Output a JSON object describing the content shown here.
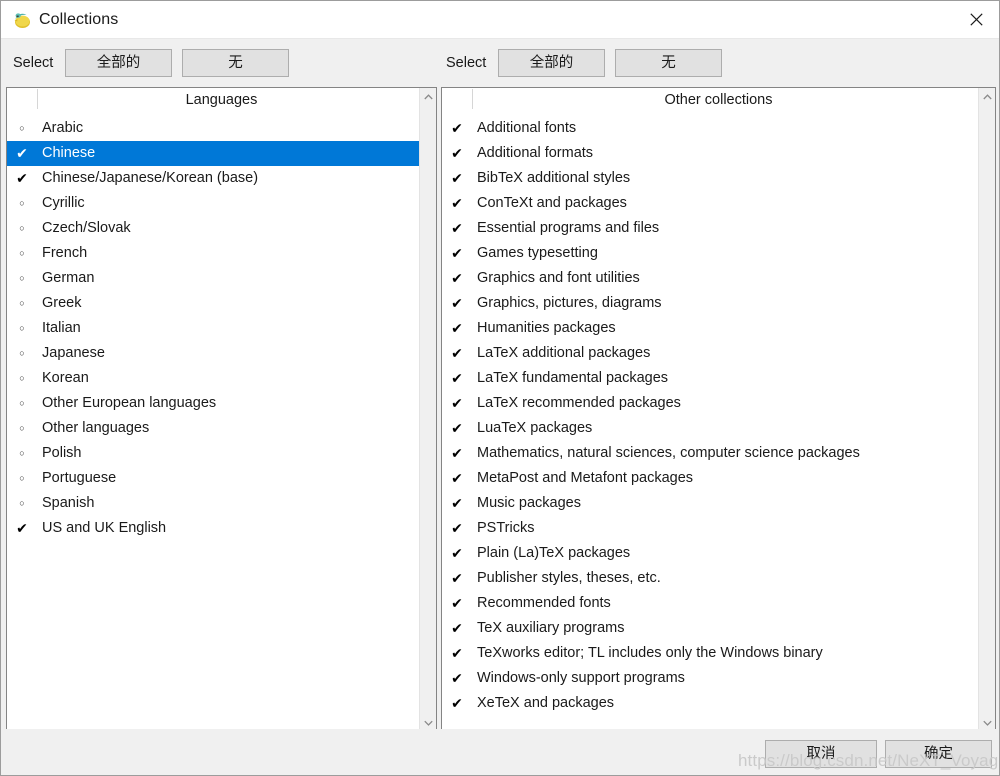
{
  "window": {
    "title": "Collections",
    "icon": "texlive-app-icon",
    "close_label": "✕"
  },
  "toolbar": {
    "left": {
      "select_label": "Select",
      "all_button": "全部的",
      "none_button": "无"
    },
    "right": {
      "select_label": "Select",
      "all_button": "全部的",
      "none_button": "无"
    }
  },
  "lists": {
    "languages": {
      "header": "Languages",
      "checked_glyph": "✔",
      "unchecked_glyph": "○",
      "items": [
        {
          "label": "Arabic",
          "checked": false,
          "selected": false
        },
        {
          "label": "Chinese",
          "checked": true,
          "selected": true
        },
        {
          "label": "Chinese/Japanese/Korean (base)",
          "checked": true,
          "selected": false
        },
        {
          "label": "Cyrillic",
          "checked": false,
          "selected": false
        },
        {
          "label": "Czech/Slovak",
          "checked": false,
          "selected": false
        },
        {
          "label": "French",
          "checked": false,
          "selected": false
        },
        {
          "label": "German",
          "checked": false,
          "selected": false
        },
        {
          "label": "Greek",
          "checked": false,
          "selected": false
        },
        {
          "label": "Italian",
          "checked": false,
          "selected": false
        },
        {
          "label": "Japanese",
          "checked": false,
          "selected": false
        },
        {
          "label": "Korean",
          "checked": false,
          "selected": false
        },
        {
          "label": "Other European languages",
          "checked": false,
          "selected": false
        },
        {
          "label": "Other languages",
          "checked": false,
          "selected": false
        },
        {
          "label": "Polish",
          "checked": false,
          "selected": false
        },
        {
          "label": "Portuguese",
          "checked": false,
          "selected": false
        },
        {
          "label": "Spanish",
          "checked": false,
          "selected": false
        },
        {
          "label": "US and UK English",
          "checked": true,
          "selected": false
        }
      ]
    },
    "other_collections": {
      "header": "Other collections",
      "checked_glyph": "✔",
      "unchecked_glyph": "○",
      "items": [
        {
          "label": "Additional fonts",
          "checked": true,
          "selected": false
        },
        {
          "label": "Additional formats",
          "checked": true,
          "selected": false
        },
        {
          "label": "BibTeX additional styles",
          "checked": true,
          "selected": false
        },
        {
          "label": "ConTeXt and packages",
          "checked": true,
          "selected": false
        },
        {
          "label": "Essential programs and files",
          "checked": true,
          "selected": false
        },
        {
          "label": "Games typesetting",
          "checked": true,
          "selected": false
        },
        {
          "label": "Graphics and font utilities",
          "checked": true,
          "selected": false
        },
        {
          "label": "Graphics, pictures, diagrams",
          "checked": true,
          "selected": false
        },
        {
          "label": "Humanities packages",
          "checked": true,
          "selected": false
        },
        {
          "label": "LaTeX additional packages",
          "checked": true,
          "selected": false
        },
        {
          "label": "LaTeX fundamental packages",
          "checked": true,
          "selected": false
        },
        {
          "label": "LaTeX recommended packages",
          "checked": true,
          "selected": false
        },
        {
          "label": "LuaTeX packages",
          "checked": true,
          "selected": false
        },
        {
          "label": "Mathematics, natural sciences, computer science packages",
          "checked": true,
          "selected": false
        },
        {
          "label": "MetaPost and Metafont packages",
          "checked": true,
          "selected": false
        },
        {
          "label": "Music packages",
          "checked": true,
          "selected": false
        },
        {
          "label": "PSTricks",
          "checked": true,
          "selected": false
        },
        {
          "label": "Plain (La)TeX packages",
          "checked": true,
          "selected": false
        },
        {
          "label": "Publisher styles, theses, etc.",
          "checked": true,
          "selected": false
        },
        {
          "label": "Recommended fonts",
          "checked": true,
          "selected": false
        },
        {
          "label": "TeX auxiliary programs",
          "checked": true,
          "selected": false
        },
        {
          "label": "TeXworks editor; TL includes only the Windows binary",
          "checked": true,
          "selected": false
        },
        {
          "label": "Windows-only support programs",
          "checked": true,
          "selected": false
        },
        {
          "label": "XeTeX and packages",
          "checked": true,
          "selected": false
        }
      ]
    }
  },
  "footer": {
    "cancel_button": "取消",
    "ok_button": "确定"
  },
  "watermark": {
    "text": "https://blog.csdn.net/NeXT_Voyager"
  },
  "colors": {
    "selection_blue": "#0078d7",
    "window_bg": "#f0f0f0",
    "list_bg": "#ffffff",
    "button_bg": "#e1e1e1",
    "button_border": "#adadad"
  }
}
